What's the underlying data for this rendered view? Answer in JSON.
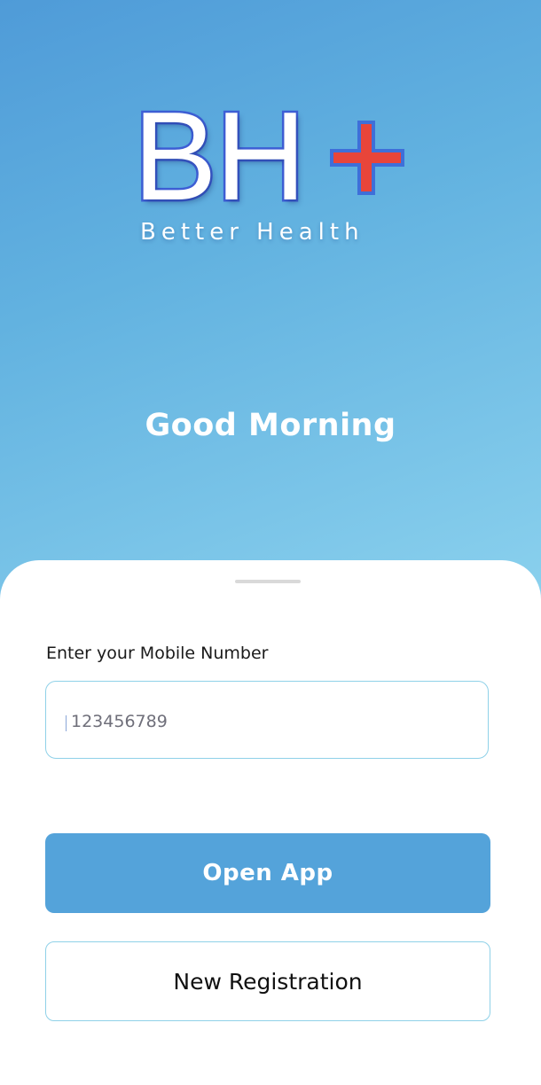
{
  "logo": {
    "letters": "BH",
    "tagline": "Better Health"
  },
  "greeting": "Good Morning",
  "form": {
    "label": "Enter your Mobile Number",
    "value": "123456789"
  },
  "buttons": {
    "primary": "Open App",
    "secondary": "New Registration"
  },
  "colors": {
    "hero_gradient_start": "#4f9bd8",
    "hero_gradient_end": "#8cd2ee",
    "primary_button": "#54a3da",
    "outline": "#8fd1e8",
    "logo_plus": "#e8453a",
    "logo_stroke": "#3e5fd6"
  },
  "icons": {
    "logo_plus": "plus-icon"
  }
}
